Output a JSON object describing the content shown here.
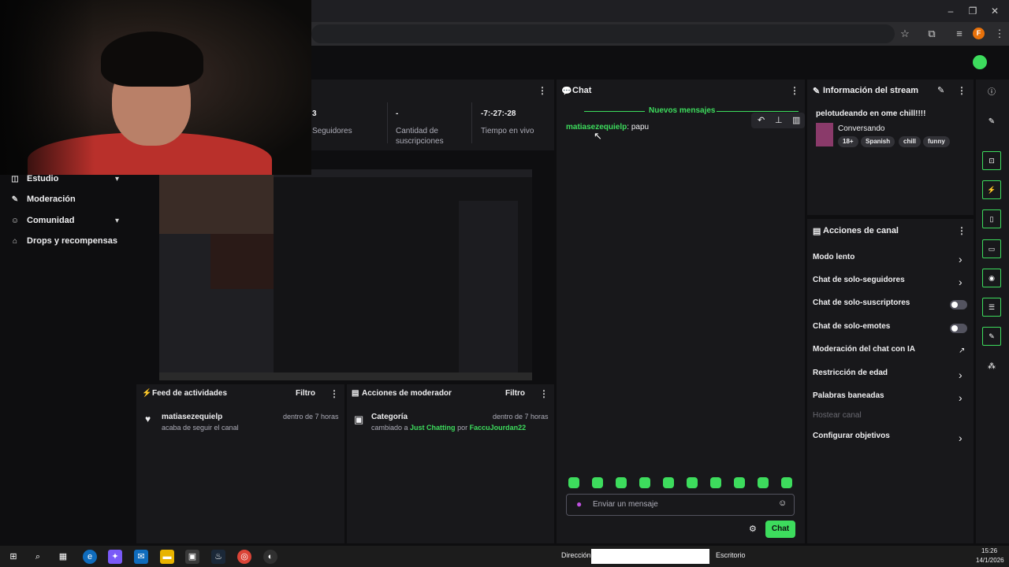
{
  "colors": {
    "accent": "#3ddc5d",
    "panel": "#18181b",
    "background": "#0e0e10",
    "muted": "#adadb8"
  },
  "browser": {
    "profile_initial": "F"
  },
  "sidenav": {
    "items": [
      {
        "label": "Estudio",
        "icon": "studio-icon",
        "has_caret": true
      },
      {
        "label": "Moderación",
        "icon": "wrench-icon",
        "has_caret": false
      },
      {
        "label": "Comunidad",
        "icon": "community-icon",
        "has_caret": true
      },
      {
        "label": "Drops y recompensas",
        "icon": "drops-icon",
        "has_caret": false
      }
    ]
  },
  "stats": {
    "followers_value": "3",
    "followers_label": "Seguidores",
    "subs_value": "-",
    "subs_label": "Cantidad de suscripciones",
    "live_value": "-7:-27:-28",
    "live_label": "Tiempo en vivo"
  },
  "activity_feed": {
    "title": "Feed de actividades",
    "filter": "Filtro",
    "items": [
      {
        "user": "matiasezequielp",
        "action": "acaba de seguir el canal",
        "time": "dentro de 7 horas"
      }
    ]
  },
  "mod_actions": {
    "title": "Acciones de moderador",
    "filter": "Filtro",
    "items": [
      {
        "title": "Categoría",
        "pre": "cambiado a",
        "category": "Just Chatting",
        "mid": "por",
        "moderator": "FaccuJourdan22",
        "time": "dentro de 7 horas"
      }
    ]
  },
  "chat": {
    "title": "Chat",
    "new_messages": "Nuevos mensajes",
    "messages": [
      {
        "user": "matiasezequielp",
        "text": ": papu"
      }
    ],
    "input_placeholder": "Enviar un mensaje",
    "send_label": "Chat",
    "emote_count": 10
  },
  "stream_info": {
    "title": "Información del stream",
    "stream_title": "pelotudeando en ome chill!!!!",
    "category": "Conversando",
    "tags": [
      "18+",
      "Spanish",
      "chill",
      "funny"
    ]
  },
  "channel_actions": {
    "title": "Acciones de canal",
    "items": [
      {
        "label": "Modo lento",
        "control": "arrow"
      },
      {
        "label": "Chat de solo-seguidores",
        "control": "arrow"
      },
      {
        "label": "Chat de solo-suscriptores",
        "control": "toggle"
      },
      {
        "label": "Chat de solo-emotes",
        "control": "toggle"
      },
      {
        "label": "Moderación del chat con IA",
        "control": "external"
      },
      {
        "label": "Restricción de edad",
        "control": "arrow"
      },
      {
        "label": "Palabras baneadas",
        "control": "arrow"
      },
      {
        "label": "Hostear canal",
        "control": "disabled"
      },
      {
        "label": "Configurar objetivos",
        "control": "arrow"
      }
    ]
  },
  "taskbar": {
    "address_label": "Dirección",
    "desktop_label": "Escritorio",
    "time": "15:26",
    "date": "14/1/2026"
  }
}
